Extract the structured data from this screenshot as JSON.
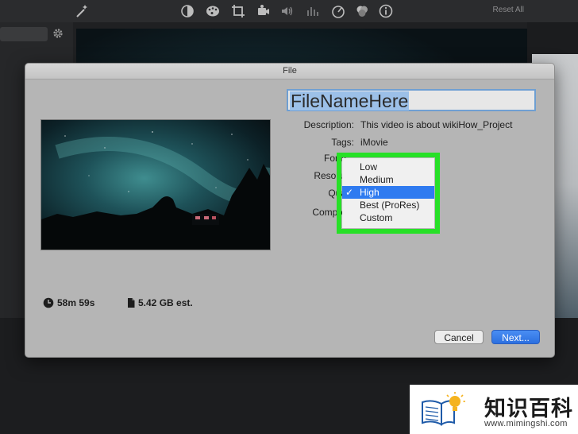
{
  "toolbar": {
    "icons": [
      "magic-wand-icon",
      "color-balance-icon",
      "color-palette-icon",
      "crop-icon",
      "stabilize-icon",
      "volume-icon",
      "equalizer-icon",
      "speed-icon",
      "filter-icon",
      "info-icon"
    ],
    "reset_label": "Reset All"
  },
  "dialog": {
    "title": "File",
    "filename": "FileNameHere",
    "description_label": "Description:",
    "description_value": "This video is about wikiHow_Project",
    "tags_label": "Tags:",
    "tags_value": "iMovie",
    "format_label": "Form",
    "resolution_label": "Resolut",
    "quality_label": "Qua",
    "compress_label": "Compre",
    "duration": "58m 59s",
    "size": "5.42 GB est.",
    "cancel_label": "Cancel",
    "next_label": "Next..."
  },
  "quality_menu": {
    "items": [
      {
        "label": "Low",
        "selected": false
      },
      {
        "label": "Medium",
        "selected": false
      },
      {
        "label": "High",
        "selected": true
      },
      {
        "label": "Best (ProRes)",
        "selected": false
      },
      {
        "label": "Custom",
        "selected": false
      }
    ],
    "check_mark": "✓",
    "highlight_color": "#27e027",
    "selected_color": "#2f7bf0"
  },
  "watermark": {
    "text_cn": "知识百科",
    "url": "www.mimingshi.com"
  }
}
